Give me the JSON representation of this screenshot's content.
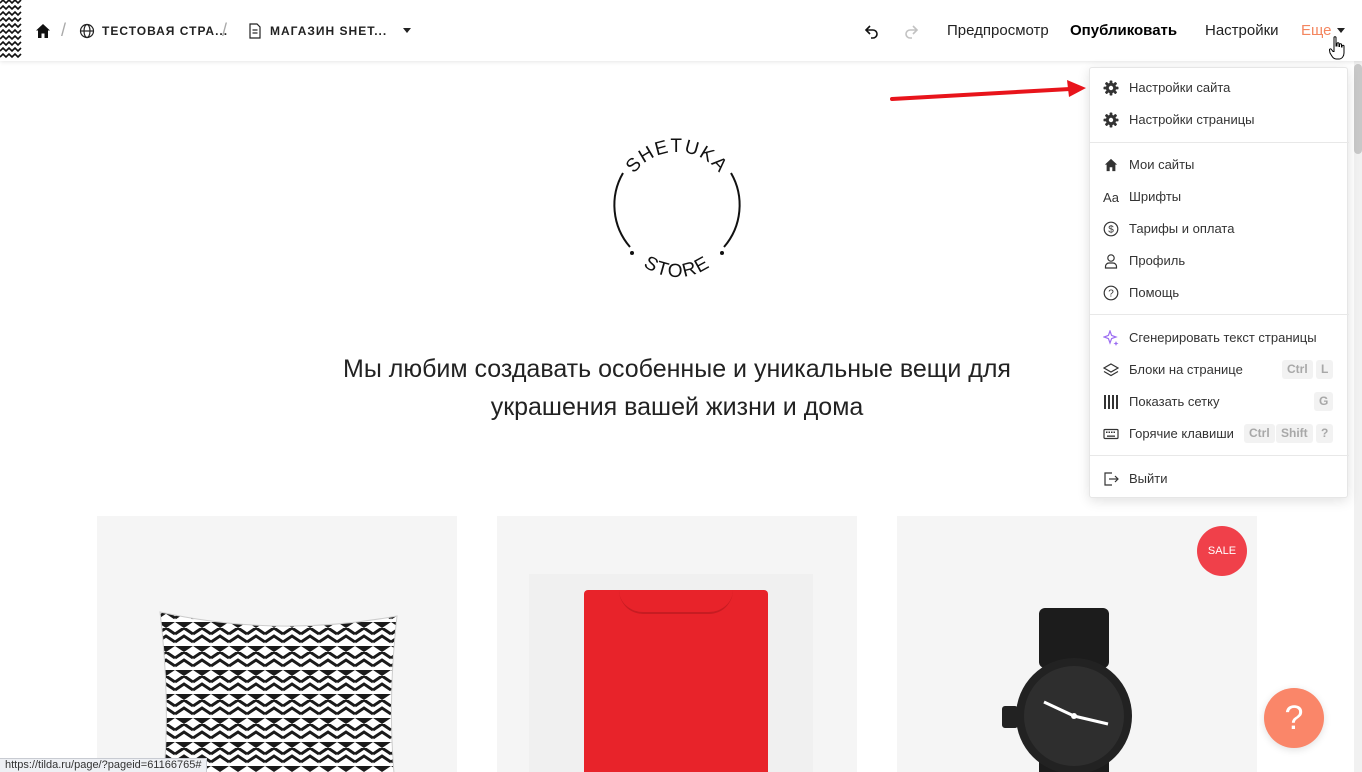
{
  "topbar": {
    "breadcrumb_project": "ТЕСТОВАЯ СТРА...",
    "breadcrumb_page": "МАГАЗИН SHET...",
    "preview": "Предпросмотр",
    "publish": "Опубликовать",
    "settings": "Настройки",
    "more": "Еще",
    "accent_color": "#f4865f"
  },
  "logo": {
    "top_text": "SHETUKA",
    "bottom_text": "STORE"
  },
  "hero": {
    "line1": "Мы любим создавать особенные и уникальные вещи для",
    "line2": "украшения вашей жизни и дома"
  },
  "products": {
    "sale_badge": "SALE"
  },
  "menu": {
    "site_settings": "Настройки сайта",
    "page_settings": "Настройки страницы",
    "my_sites": "Мои сайты",
    "fonts": "Шрифты",
    "fonts_icon_text": "Aa",
    "tariffs": "Тарифы и оплата",
    "profile": "Профиль",
    "help": "Помощь",
    "generate_text": "Сгенерировать текст страницы",
    "blocks_on_page": "Блоки на странице",
    "show_grid": "Показать сетку",
    "hotkeys": "Горячие клавиши",
    "logout": "Выйти",
    "kbd_ctrl": "Ctrl",
    "kbd_l": "L",
    "kbd_g": "G",
    "kbd_shift": "Shift",
    "kbd_q": "?"
  },
  "help_fab": "?",
  "status_url": "https://tilda.ru/page/?pageid=61166765#"
}
